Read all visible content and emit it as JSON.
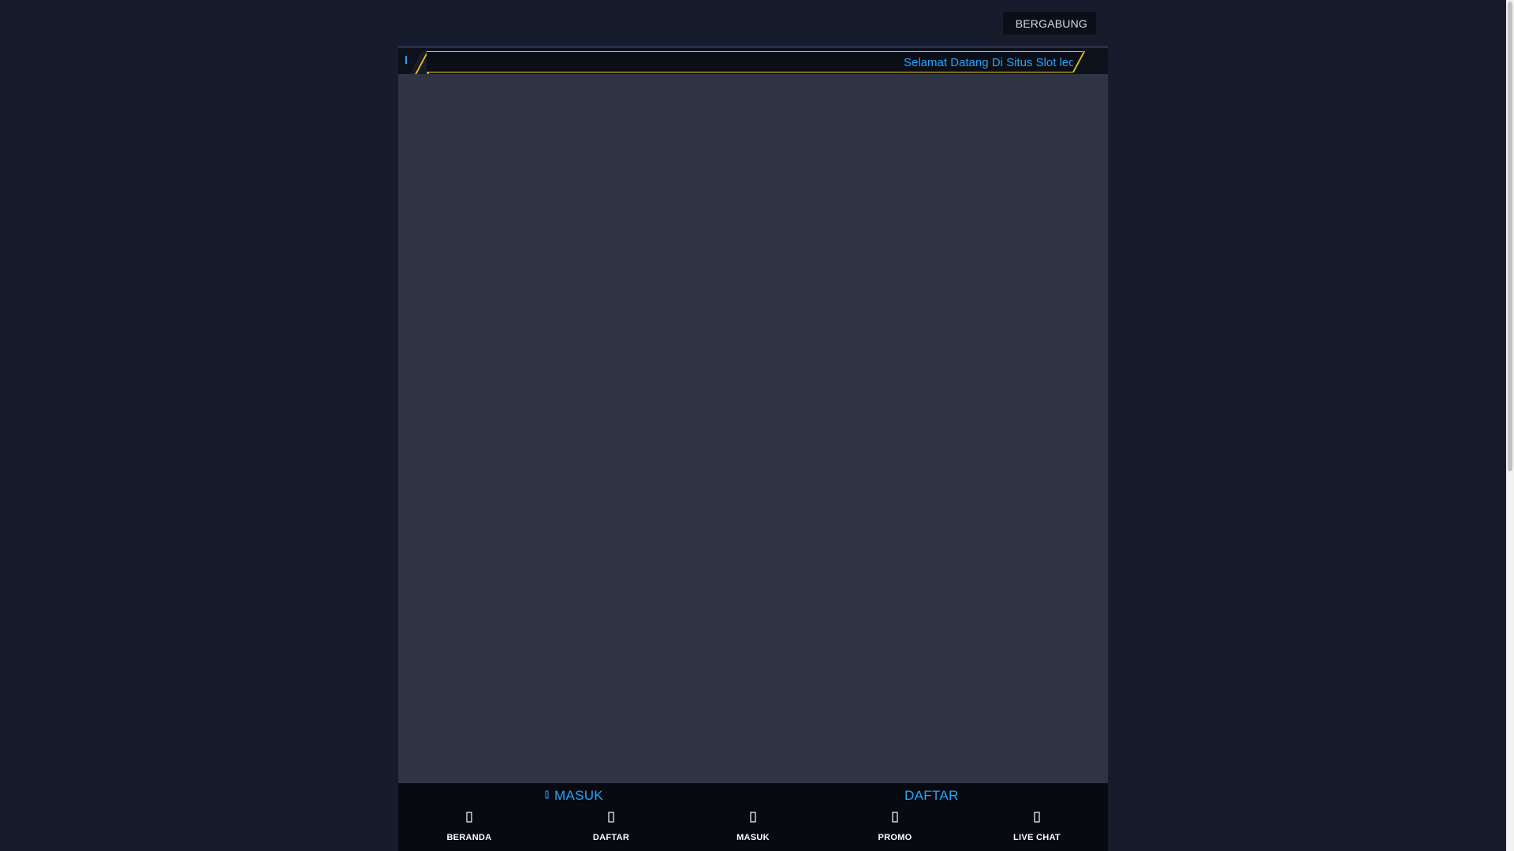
{
  "header": {
    "join_label": "BERGABUNG"
  },
  "ticker": {
    "icon": "speaker-icon",
    "message": "Selamat Datang Di Situs Slot ledak"
  },
  "auth": {
    "login_label": "MASUK",
    "login_icon": "sign-in-icon",
    "register_label": "DAFTAR"
  },
  "nav": {
    "items": [
      {
        "label": "BERANDA",
        "icon": "home-icon"
      },
      {
        "label": "DAFTAR",
        "icon": "user-plus-icon"
      },
      {
        "label": "MASUK",
        "icon": "sign-in-icon"
      },
      {
        "label": "PROMO",
        "icon": "gift-icon"
      },
      {
        "label": "LIVE CHAT",
        "icon": "chat-icon"
      }
    ]
  },
  "colors": {
    "background": "#161c2b",
    "banner": "#2e3443",
    "accent_blue": "#1ea7ff",
    "accent_yellow": "#f0c419",
    "bar": "#070a10"
  }
}
